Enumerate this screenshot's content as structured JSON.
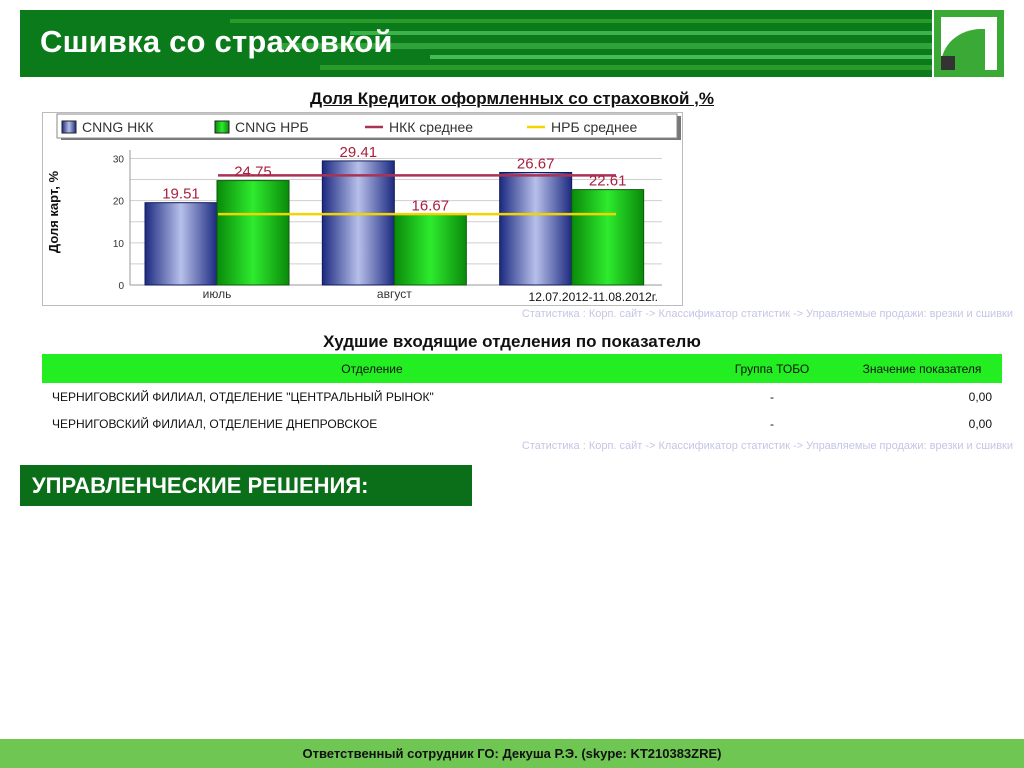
{
  "header": {
    "title": "Сшивка со страховкой"
  },
  "colors": {
    "header_green": "#0b7a1a",
    "bar_nkk": "#3a4aa8",
    "bar_nrb": "#18b818",
    "line_nkk": "#aa3355",
    "line_nrb": "#f2d400",
    "table_header": "#22ee22",
    "footer": "#6fc653"
  },
  "chart_data": {
    "type": "bar",
    "title": "Доля Кредиток оформленных со страховкой ,%",
    "categories": [
      "июль",
      "август",
      ""
    ],
    "series": [
      {
        "name": "CNNG НКК",
        "values": [
          19.51,
          29.41,
          26.67
        ]
      },
      {
        "name": "CNNG НРБ",
        "values": [
          24.75,
          16.67,
          22.61
        ]
      }
    ],
    "reference_lines": [
      {
        "name": "НКК среднее",
        "value": 26
      },
      {
        "name": "НРБ среднее",
        "value": 16.8
      }
    ],
    "ylabel": "Доля карт, %",
    "xlabel": "",
    "ylim": [
      0,
      32
    ],
    "yticks": [
      0,
      10,
      20,
      30
    ],
    "period": "12.07.2012-11.08.2012г.",
    "legend": "top",
    "grid": true
  },
  "chart_link": "Статистика : Корп. сайт -> Классификатор статистик -> Управляемые продажи: врезки и сшивки",
  "table": {
    "title": "Худшие входящие отделения по показателю",
    "headers": [
      "Отделение",
      "Группа ТОБО",
      "Значение показателя"
    ],
    "rows": [
      [
        "ЧЕРНИГОВСКИЙ ФИЛИАЛ, ОТДЕЛЕНИЕ \"ЦЕНТРАЛЬНЫЙ РЫНОК\"",
        "-",
        "0,00"
      ],
      [
        "ЧЕРНИГОВСКИЙ ФИЛИАЛ, ОТДЕЛЕНИЕ ДНЕПРОВСКОЕ",
        "-",
        "0,00"
      ]
    ],
    "link": "Статистика : Корп. сайт -> Классификатор статистик -> Управляемые продажи: врезки и сшивки"
  },
  "decisions": {
    "title": "УПРАВЛЕНЧЕСКИЕ РЕШЕНИЯ:"
  },
  "footer": {
    "text": "Ответственный сотрудник ГО: Декуша Р.Э. (skype: KT210383ZRE)"
  }
}
